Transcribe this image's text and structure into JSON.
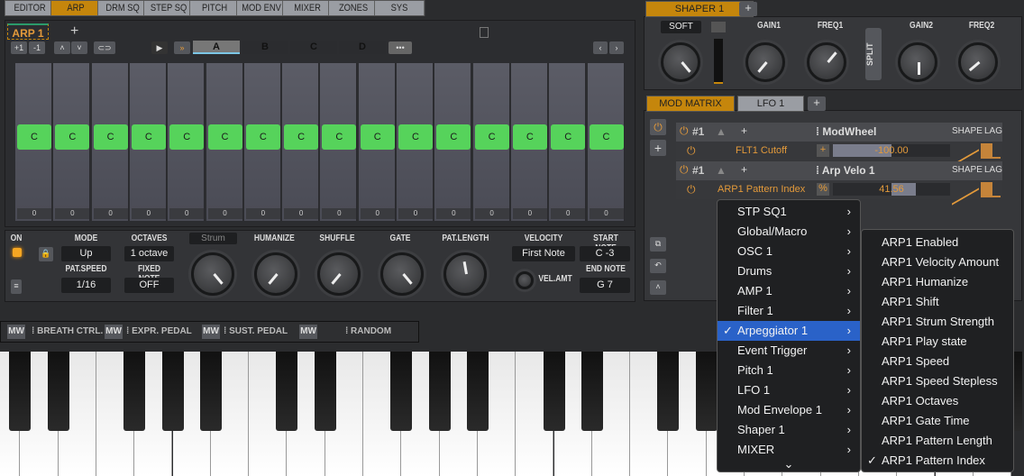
{
  "tabs": [
    "EDITOR",
    "ARP",
    "DRM SQ",
    "STEP SQ",
    "PITCH",
    "MOD ENV",
    "MIXER",
    "ZONES",
    "SYS"
  ],
  "active_tab": "ARP",
  "arp": {
    "title": "ARP 1",
    "add": "+",
    "transpose_up": "+1",
    "transpose_down": "-1",
    "patterns": [
      "A",
      "B",
      "C",
      "D"
    ],
    "more": "•••",
    "steps": [
      "C",
      "C",
      "C",
      "C",
      "C",
      "C",
      "C",
      "C",
      "C",
      "C",
      "C",
      "C",
      "C",
      "C",
      "C",
      "C"
    ],
    "step_values": [
      "0",
      "0",
      "0",
      "0",
      "0",
      "0",
      "0",
      "0",
      "0",
      "0",
      "0",
      "0",
      "0",
      "0",
      "0",
      "0"
    ],
    "on_label": "ON",
    "mode_label": "MODE",
    "mode": "Up",
    "octaves_label": "OCTAVES",
    "octaves": "1 octave",
    "pat_speed_label": "PAT.SPEED",
    "pat_speed": "1/16",
    "fixed_note_label": "FIXED NOTE",
    "fixed_note": "OFF",
    "strum": "Strum",
    "humanize": "HUMANIZE",
    "shuffle": "SHUFFLE",
    "gate": "GATE",
    "pat_length": "PAT.LENGTH",
    "velocity_label": "VELOCITY",
    "velocity": "First Note",
    "vel_amt": "VEL.AMT",
    "start_note_label": "START NOTE",
    "start_note": "C -3",
    "end_note_label": "END NOTE",
    "end_note": "G 7"
  },
  "shaper": {
    "tab": "SHAPER 1",
    "add": "+",
    "mode": "SOFT",
    "gain1": "GAIN1",
    "freq1": "FREQ1",
    "split": "SPLIT",
    "gain2": "GAIN2",
    "freq2": "FREQ2"
  },
  "mod_matrix": {
    "tab": "MOD MATRIX",
    "lfo_tab": "LFO 1",
    "add": "+",
    "slots": [
      {
        "num": "#1",
        "source": "ModWheel",
        "shape": "SHAPE",
        "lag": "LAG",
        "target": "FLT1 Cutoff",
        "polarity": "+",
        "amount": "-100.00",
        "fill": -1.0
      },
      {
        "num": "#1",
        "source": "Arp Velo 1",
        "shape": "SHAPE",
        "lag": "LAG",
        "target": "ARP1 Pattern Index",
        "polarity": "%",
        "amount": "41.56",
        "fill": 0.4156
      }
    ]
  },
  "controllers": [
    "MW",
    "BREATH CTRL.",
    "MW",
    "EXPR. PEDAL",
    "MW",
    "SUST. PEDAL",
    "MW",
    "RANDOM"
  ],
  "menu": {
    "items": [
      "STP SQ1",
      "Global/Macro",
      "OSC 1",
      "Drums",
      "AMP 1",
      "Filter 1",
      "Arpeggiator 1",
      "Event Trigger",
      "Pitch 1",
      "LFO 1",
      "Mod Envelope 1",
      "Shaper 1",
      "MIXER"
    ],
    "selected": "Arpeggiator 1",
    "more": "⌄"
  },
  "submenu": {
    "items": [
      "ARP1 Enabled",
      "ARP1 Velocity Amount",
      "ARP1 Humanize",
      "ARP1 Shift",
      "ARP1 Strum Strength",
      "ARP1 Play state",
      "ARP1 Speed",
      "ARP1 Speed Stepless",
      "ARP1 Octaves",
      "ARP1 Gate Time",
      "ARP1 Pattern Length",
      "ARP1 Pattern Index"
    ],
    "checked": "ARP1 Pattern Index"
  },
  "colors": {
    "accent": "#c5860c",
    "step": "#56d35b",
    "menu_sel": "#2a62c8",
    "orange_text": "#e39a3b"
  }
}
